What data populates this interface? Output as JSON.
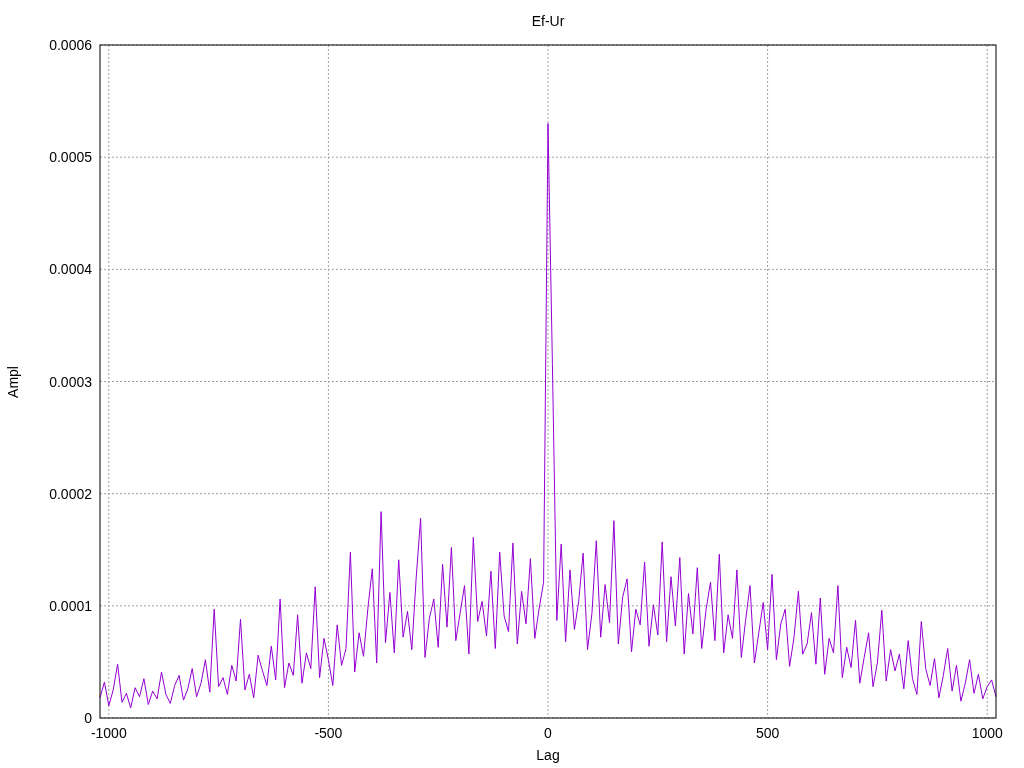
{
  "chart_data": {
    "type": "line",
    "title": "Ef-Ur",
    "xlabel": "Lag",
    "ylabel": "Ampl",
    "grid": true,
    "xlim": [
      -1020,
      1020
    ],
    "ylim": [
      0,
      0.0006
    ],
    "xticks": [
      {
        "value": -1000,
        "label": "-1000"
      },
      {
        "value": -500,
        "label": "-500"
      },
      {
        "value": 0,
        "label": "0"
      },
      {
        "value": 500,
        "label": "500"
      },
      {
        "value": 1000,
        "label": "1000"
      }
    ],
    "yticks": [
      {
        "value": 0,
        "label": "0"
      },
      {
        "value": 0.0001,
        "label": "0.0001"
      },
      {
        "value": 0.0002,
        "label": "0.0002"
      },
      {
        "value": 0.0003,
        "label": "0.0003"
      },
      {
        "value": 0.0004,
        "label": "0.0004"
      },
      {
        "value": 0.0005,
        "label": "0.0005"
      },
      {
        "value": 0.0006,
        "label": "0.0006"
      }
    ],
    "x": [
      -1020,
      -1010,
      -1000,
      -990,
      -980,
      -970,
      -960,
      -950,
      -940,
      -930,
      -920,
      -910,
      -900,
      -890,
      -880,
      -870,
      -860,
      -850,
      -840,
      -830,
      -820,
      -810,
      -800,
      -790,
      -780,
      -770,
      -760,
      -750,
      -740,
      -730,
      -720,
      -710,
      -700,
      -690,
      -680,
      -670,
      -660,
      -650,
      -640,
      -630,
      -620,
      -610,
      -600,
      -590,
      -580,
      -570,
      -560,
      -550,
      -540,
      -530,
      -520,
      -510,
      -500,
      -490,
      -480,
      -470,
      -460,
      -450,
      -440,
      -430,
      -420,
      -410,
      -400,
      -390,
      -380,
      -370,
      -360,
      -350,
      -340,
      -330,
      -320,
      -310,
      -300,
      -290,
      -280,
      -270,
      -260,
      -250,
      -240,
      -230,
      -220,
      -210,
      -200,
      -190,
      -180,
      -170,
      -160,
      -150,
      -140,
      -130,
      -120,
      -110,
      -100,
      -90,
      -80,
      -70,
      -60,
      -50,
      -40,
      -30,
      -20,
      -10,
      0,
      10,
      20,
      30,
      40,
      50,
      60,
      70,
      80,
      90,
      100,
      110,
      120,
      130,
      140,
      150,
      160,
      170,
      180,
      190,
      200,
      210,
      220,
      230,
      240,
      250,
      260,
      270,
      280,
      290,
      300,
      310,
      320,
      330,
      340,
      350,
      360,
      370,
      380,
      390,
      400,
      410,
      420,
      430,
      440,
      450,
      460,
      470,
      480,
      490,
      500,
      510,
      520,
      530,
      540,
      550,
      560,
      570,
      580,
      590,
      600,
      610,
      620,
      630,
      640,
      650,
      660,
      670,
      680,
      690,
      700,
      710,
      720,
      730,
      740,
      750,
      760,
      770,
      780,
      790,
      800,
      810,
      820,
      830,
      840,
      850,
      860,
      870,
      880,
      890,
      900,
      910,
      920,
      930,
      940,
      950,
      960,
      970,
      980,
      990,
      1000,
      1010,
      1020
    ],
    "series": [
      {
        "color": "#9400d3",
        "values": [
          1.8e-05,
          3.2e-05,
          1.1e-05,
          2.5e-05,
          4.8e-05,
          1.4e-05,
          2.2e-05,
          9e-06,
          2.7e-05,
          1.9e-05,
          3.5e-05,
          1.2e-05,
          2.4e-05,
          1.7e-05,
          4.1e-05,
          2.1e-05,
          1.3e-05,
          2.9e-05,
          3.8e-05,
          1.6e-05,
          2.6e-05,
          4.4e-05,
          1.9e-05,
          3.1e-05,
          5.2e-05,
          2.3e-05,
          9.7e-05,
          2.8e-05,
          3.6e-05,
          2.1e-05,
          4.7e-05,
          3.3e-05,
          8.8e-05,
          2.5e-05,
          3.9e-05,
          1.8e-05,
          5.6e-05,
          4.2e-05,
          2.9e-05,
          6.4e-05,
          3.4e-05,
          0.000106,
          2.7e-05,
          4.9e-05,
          3.8e-05,
          9.2e-05,
          3.1e-05,
          5.8e-05,
          4.4e-05,
          0.000117,
          3.6e-05,
          7.1e-05,
          5.2e-05,
          2.9e-05,
          8.3e-05,
          4.7e-05,
          6.2e-05,
          0.000148,
          4.1e-05,
          7.6e-05,
          5.5e-05,
          9.8e-05,
          0.000133,
          4.9e-05,
          0.000184,
          6.7e-05,
          0.000112,
          5.8e-05,
          0.000141,
          7.2e-05,
          9.5e-05,
          6.1e-05,
          0.000125,
          0.000178,
          5.4e-05,
          8.9e-05,
          0.000106,
          6.3e-05,
          0.000137,
          8.1e-05,
          0.000152,
          6.9e-05,
          9.4e-05,
          0.000118,
          5.7e-05,
          0.000161,
          8.6e-05,
          0.000104,
          7.3e-05,
          0.000131,
          6.2e-05,
          0.000148,
          9.1e-05,
          7.7e-05,
          0.000156,
          6.6e-05,
          0.000113,
          8.4e-05,
          0.000142,
          7.1e-05,
          9.8e-05,
          0.000121,
          0.00053,
          0.000316,
          8.7e-05,
          0.000155,
          6.8e-05,
          0.000132,
          7.9e-05,
          0.000104,
          0.000147,
          6.1e-05,
          9.3e-05,
          0.000158,
          7.2e-05,
          0.000119,
          8.5e-05,
          0.000176,
          6.6e-05,
          0.000108,
          0.000124,
          5.9e-05,
          9.7e-05,
          8.3e-05,
          0.000139,
          6.4e-05,
          0.000101,
          7.4e-05,
          0.000157,
          6.8e-05,
          0.000126,
          8.2e-05,
          0.000143,
          5.7e-05,
          0.000111,
          7.5e-05,
          0.000134,
          6.2e-05,
          9.7e-05,
          0.000121,
          6.9e-05,
          0.000146,
          5.8e-05,
          9.2e-05,
          7.1e-05,
          0.000132,
          5.4e-05,
          8.7e-05,
          0.000118,
          4.9e-05,
          7.6e-05,
          0.000103,
          6.1e-05,
          0.000128,
          5.2e-05,
          8.4e-05,
          9.7e-05,
          4.6e-05,
          7.2e-05,
          0.000113,
          5.7e-05,
          6.6e-05,
          9.4e-05,
          4.8e-05,
          0.000107,
          3.9e-05,
          7.1e-05,
          5.8e-05,
          0.000118,
          3.6e-05,
          6.3e-05,
          4.5e-05,
          8.7e-05,
          3.1e-05,
          5.4e-05,
          7.6e-05,
          2.8e-05,
          4.9e-05,
          9.6e-05,
          3.3e-05,
          6.1e-05,
          4.2e-05,
          5.7e-05,
          2.6e-05,
          6.9e-05,
          3.5e-05,
          2.1e-05,
          8.6e-05,
          4.4e-05,
          2.9e-05,
          5.3e-05,
          1.8e-05,
          3.8e-05,
          6.2e-05,
          2.4e-05,
          4.7e-05,
          1.5e-05,
          3.1e-05,
          5.2e-05,
          2.2e-05,
          3.9e-05,
          1.7e-05,
          2.8e-05,
          3.4e-05,
          1.9e-05
        ]
      }
    ]
  }
}
